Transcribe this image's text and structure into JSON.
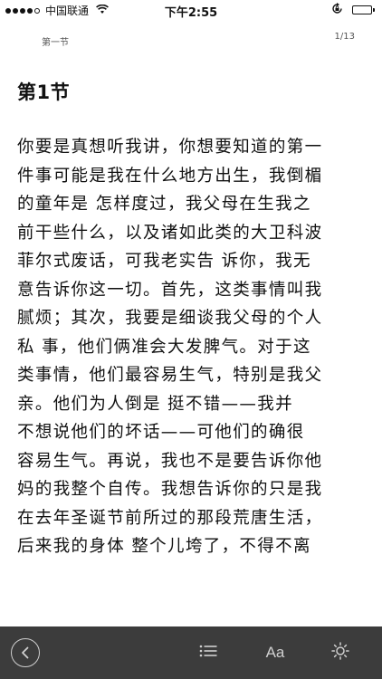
{
  "status_bar": {
    "carrier": "中国联通",
    "time": "下午2:55",
    "battery_level": 0.9
  },
  "reader": {
    "chapter_name": "第一节",
    "page_indicator": "1/13",
    "chapter_title": "第1节",
    "lines": [
      "你要是真想听我讲，你想要知道的第一",
      "件事可能是我在什么地方出生，我倒楣",
      "的童年是 怎样度过，我父母在生我之",
      "前干些什么，以及诸如此类的大卫科波",
      "菲尔式废话，可我老实告 诉你，我无",
      "意告诉你这一切。首先，这类事情叫我",
      "腻烦；其次，我要是细谈我父母的个人",
      "私 事，他们俩准会大发脾气。对于这",
      "类事情，他们最容易生气，特别是我父",
      "亲。他们为人倒是 挺不错——我并",
      "不想说他们的坏话——可他们的确很",
      "容易生气。再说，我也不是要告诉你他",
      "妈的我整个自传。我想告诉你的只是我",
      "在去年圣诞节前所过的那段荒唐生活，",
      "后来我的身体 整个儿垮了，不得不离"
    ]
  },
  "toolbar": {
    "back_icon": "chevron-left-icon",
    "toc_icon": "list-icon",
    "font_label": "Aa",
    "brightness_icon": "sun-icon"
  },
  "colors": {
    "toolbar_bg": "#3c3c3c",
    "toolbar_icon": "#d0d0d0",
    "text": "#111111"
  }
}
